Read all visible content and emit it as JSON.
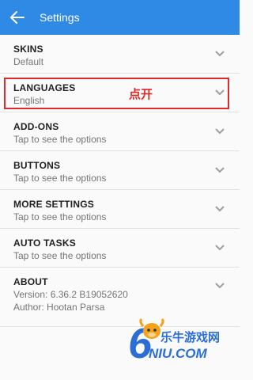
{
  "appbar": {
    "title": "Settings",
    "back_icon": "arrow-left-icon"
  },
  "colors": {
    "appbar": "#2f8ae6",
    "highlight": "#e02a2a",
    "watermark": "#2b6fd6"
  },
  "rows": [
    {
      "label": "SKINS",
      "sub": "Default"
    },
    {
      "label": "LANGUAGES",
      "sub": "English"
    },
    {
      "label": "ADD-ONS",
      "sub": "Tap to see the options"
    },
    {
      "label": "BUTTONS",
      "sub": "Tap to see the options"
    },
    {
      "label": "MORE SETTINGS",
      "sub": "Tap to see the options"
    },
    {
      "label": "AUTO TASKS",
      "sub": "Tap to see the options"
    },
    {
      "label": "ABOUT",
      "sub1": "Version: 6.36.2  B19052620",
      "sub2": "Author: Hootan Parsa"
    }
  ],
  "annotation": "点开",
  "watermark": {
    "text1": "乐牛游戏网",
    "text2": "NIU.COM"
  }
}
